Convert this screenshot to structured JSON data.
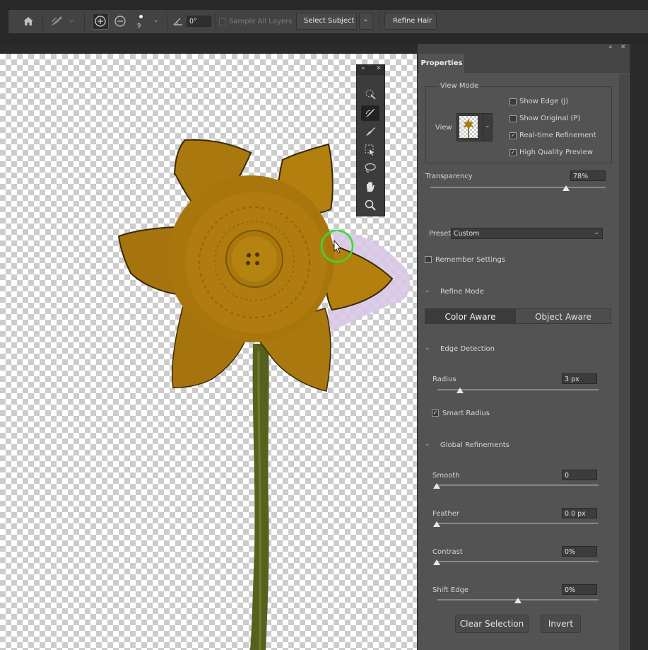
{
  "options_bar": {
    "brush_size": "9",
    "angle_value": "0°",
    "sample_all_layers_label": "Sample All Layers",
    "select_subject_label": "Select Subject",
    "refine_hair_label": "Refine Hair"
  },
  "properties": {
    "tab_label": "Properties",
    "view_mode": {
      "group_label": "View Mode",
      "view_label": "View",
      "show_edge": "Show Edge (J)",
      "show_original": "Show Original (P)",
      "realtime_refinement": "Real-time Refinement",
      "high_quality_preview": "High Quality Preview",
      "show_edge_checked": false,
      "show_original_checked": false,
      "realtime_checked": true,
      "hq_checked": true
    },
    "transparency": {
      "label": "Transparency",
      "value": "78%",
      "fraction": 0.78
    },
    "preset": {
      "label": "Preset",
      "value": "Custom"
    },
    "remember_settings": {
      "label": "Remember Settings",
      "checked": false
    },
    "refine_mode": {
      "label": "Refine Mode",
      "options": [
        "Color Aware",
        "Object Aware"
      ],
      "selected": "Color Aware"
    },
    "edge_detection": {
      "label": "Edge Detection",
      "radius_label": "Radius",
      "radius_value": "3 px",
      "radius_fraction": 0.15,
      "smart_radius_label": "Smart Radius",
      "smart_radius_checked": true
    },
    "global_refinements": {
      "label": "Global Refinements",
      "smooth": {
        "label": "Smooth",
        "value": "0",
        "fraction": 0
      },
      "feather": {
        "label": "Feather",
        "value": "0.0 px",
        "fraction": 0
      },
      "contrast": {
        "label": "Contrast",
        "value": "0%",
        "fraction": 0
      },
      "shift_edge": {
        "label": "Shift Edge",
        "value": "0%",
        "fraction": 0.5
      }
    },
    "clear_selection_label": "Clear Selection",
    "invert_label": "Invert"
  },
  "colors": {
    "flower": "#b07d0f",
    "stem": "#56611e",
    "brush_cursor": "#33dd33",
    "selection_tint": "#d9c8e6"
  }
}
